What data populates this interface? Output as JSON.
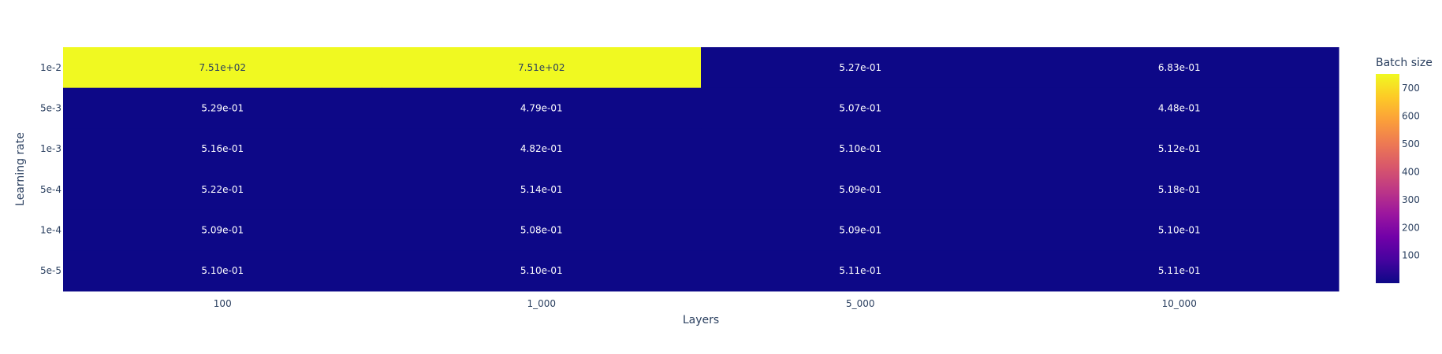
{
  "chart_data": {
    "type": "heatmap",
    "x_categories": [
      "100",
      "1_000",
      "5_000",
      "10_000"
    ],
    "y_categories": [
      "1e-2",
      "5e-3",
      "1e-3",
      "5e-4",
      "1e-4",
      "5e-5"
    ],
    "values": [
      [
        751,
        751,
        0.527,
        0.683
      ],
      [
        0.529,
        0.479,
        0.507,
        0.448
      ],
      [
        0.516,
        0.482,
        0.51,
        0.512
      ],
      [
        0.522,
        0.514,
        0.509,
        0.518
      ],
      [
        0.509,
        0.508,
        0.509,
        0.51
      ],
      [
        0.51,
        0.51,
        0.511,
        0.511
      ]
    ],
    "labels": [
      [
        "7.51e+02",
        "7.51e+02",
        "5.27e-01",
        "6.83e-01"
      ],
      [
        "5.29e-01",
        "4.79e-01",
        "5.07e-01",
        "4.48e-01"
      ],
      [
        "5.16e-01",
        "4.82e-01",
        "5.10e-01",
        "5.12e-01"
      ],
      [
        "5.22e-01",
        "5.14e-01",
        "5.09e-01",
        "5.18e-01"
      ],
      [
        "5.09e-01",
        "5.08e-01",
        "5.09e-01",
        "5.10e-01"
      ],
      [
        "5.10e-01",
        "5.10e-01",
        "5.11e-01",
        "5.11e-01"
      ]
    ],
    "xlabel": "Layers",
    "ylabel": "Learning rate",
    "colorbar": {
      "title": "Batch size",
      "range": [
        0.448,
        751
      ],
      "ticks": [
        100,
        200,
        300,
        400,
        500,
        600,
        700
      ],
      "tick_labels": [
        "100",
        "200",
        "300",
        "400",
        "500",
        "600",
        "700"
      ],
      "colorscale": [
        "#0d0887",
        "#46039f",
        "#7201a8",
        "#9c179e",
        "#bd3786",
        "#d8576b",
        "#ed7953",
        "#fb9f3a",
        "#fdca26",
        "#f0f921"
      ]
    }
  }
}
